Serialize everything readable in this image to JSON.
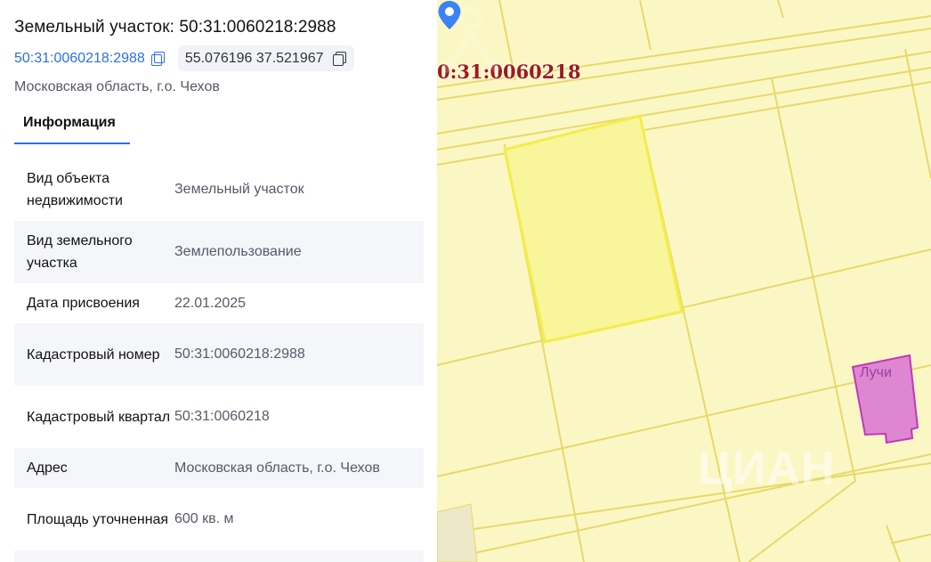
{
  "header": {
    "title": "Земельный участок: 50:31:0060218:2988",
    "cadastral_link": "50:31:0060218:2988",
    "coordinates": "55.076196 37.521967",
    "address": "Московская область, г.о. Чехов"
  },
  "tabs": [
    {
      "label": "Информация",
      "active": true
    }
  ],
  "info_rows": [
    {
      "label": "Вид объекта недвижимости",
      "value": "Земельный участок"
    },
    {
      "label": "Вид земельного участка",
      "value": "Землепользование"
    },
    {
      "label": "Дата присвоения",
      "value": "22.01.2025"
    },
    {
      "label": "Кадастровый номер",
      "value": "50:31:0060218:2988"
    },
    {
      "label": "Кадастровый квартал",
      "value": "50:31:0060218"
    },
    {
      "label": "Адрес",
      "value": "Московская область, г.о. Чехов"
    },
    {
      "label": "Площадь уточненная",
      "value": "600 кв. м"
    }
  ],
  "map": {
    "quarter_label": "0:31:0060218",
    "poi_label": "Лучи",
    "watermark": "ЦИАН",
    "colors": {
      "background": "#fbf7c4",
      "parcel_border": "#e6d96a",
      "selected_parcel_fill": "#f8f59a",
      "selected_parcel_border": "#f4ec4a",
      "poi_fill": "#df86d3",
      "poi_border": "#c037b7",
      "pin": "#3b82f6"
    },
    "icons": {
      "pin": "location-pin-icon",
      "copy": "copy-icon"
    }
  },
  "colors": {
    "accent": "#2b6fe6",
    "row_alt_background": "#f5f6fa",
    "chip_background": "#f1f3f8"
  }
}
